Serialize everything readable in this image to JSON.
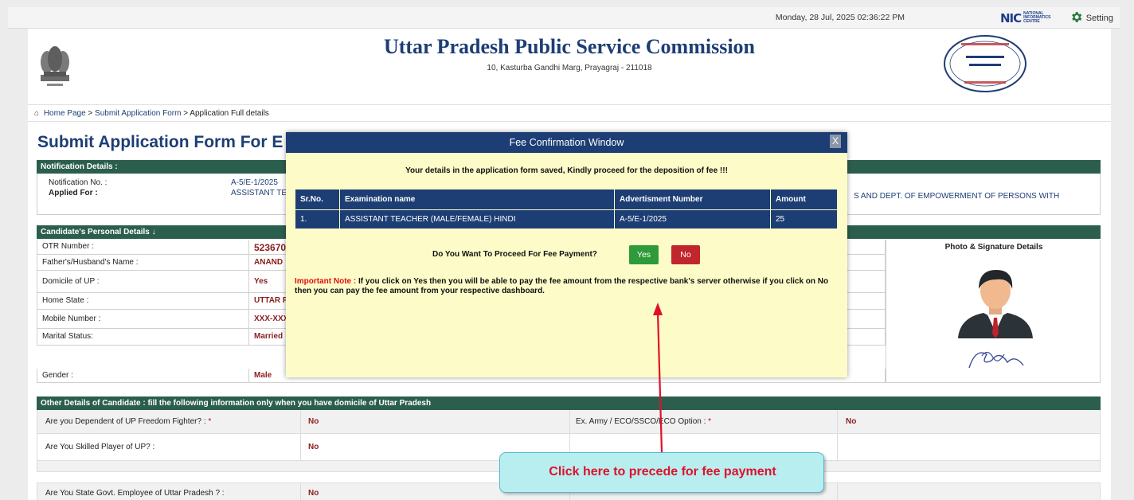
{
  "topbar": {
    "datetime": "Monday, 28 Jul, 2025 02:36:22 PM",
    "nic_logo": "NIC",
    "nic_sub": "NATIONAL INFORMATICS CENTRE",
    "setting_label": "Setting"
  },
  "header": {
    "title": "Uttar Pradesh Public Service Commission",
    "address": "10, Kasturba Gandhi Marg, Prayagraj - 211018"
  },
  "breadcrumb": {
    "items": [
      "Home Page",
      "Submit Application Form",
      "Application Full details"
    ],
    "sep": ">"
  },
  "page_title": "Submit Application Form For E",
  "notification": {
    "header": "Notification Details :",
    "no_label": "Notification No. :",
    "no_value": "A-5/E-1/2025",
    "applied_label": "Applied For :",
    "applied_value": "ASSISTANT TE",
    "applied_tail": "S AND DEPT. OF EMPOWERMENT OF PERSONS WITH"
  },
  "personal": {
    "header": "Candidate's Personal Details ↓",
    "rows": [
      {
        "label": "OTR Number :",
        "value": "523670"
      },
      {
        "label": "Father's/Husband's Name :",
        "value": "ANAND"
      },
      {
        "label": "Domicile of UP :",
        "value": "Yes"
      },
      {
        "label": "Home State :",
        "value": "UTTAR P"
      },
      {
        "label": "Mobile Number :",
        "value": "XXX-XXX"
      },
      {
        "label": "Marital Status:",
        "value": "Married"
      },
      {
        "label": "Gender :",
        "value": "Male"
      }
    ],
    "photo_title": "Photo & Signature Details"
  },
  "other": {
    "header": "Other Details of Candidate : fill the following information only when you have domicile of Uttar Pradesh",
    "rows": [
      {
        "q": "Are you Dependent of UP Freedom Fighter? :",
        "a": "No",
        "q2": "Ex. Army / ECO/SSCO/ECO Option :",
        "a2": "No"
      },
      {
        "q": "Are You Skilled Player of UP? :",
        "a": "No"
      },
      {
        "q": "Are You State Govt. Employee of Uttar Pradesh ? :",
        "a": "No"
      }
    ]
  },
  "modal": {
    "title": "Fee Confirmation Window",
    "close": "X",
    "message": "Your details in the application form saved, Kindly proceed for the deposition of fee !!!",
    "table": {
      "headers": [
        "Sr.No.",
        "Examination name",
        "Advertisment Number",
        "Amount"
      ],
      "rows": [
        [
          "1.",
          "ASSISTANT TEACHER (MALE/FEMALE) HINDI",
          "A-5/E-1/2025",
          "25"
        ]
      ]
    },
    "question": "Do You Want To Proceed For Fee Payment?",
    "yes": "Yes",
    "no": "No",
    "note_label": "Important Note :",
    "note_text": " If you click on Yes then you will be able to pay the fee amount from the respective bank's server otherwise if you click on No then you can pay the fee amount from your respective dashboard."
  },
  "callout": "Click here to precede for fee payment",
  "colors": {
    "brand": "#1d3e74",
    "section": "#2c5e4e",
    "modal_bg": "#fdfcc9",
    "yes": "#2f9a3a",
    "no": "#c0262c",
    "callout_text": "#e0102a"
  }
}
